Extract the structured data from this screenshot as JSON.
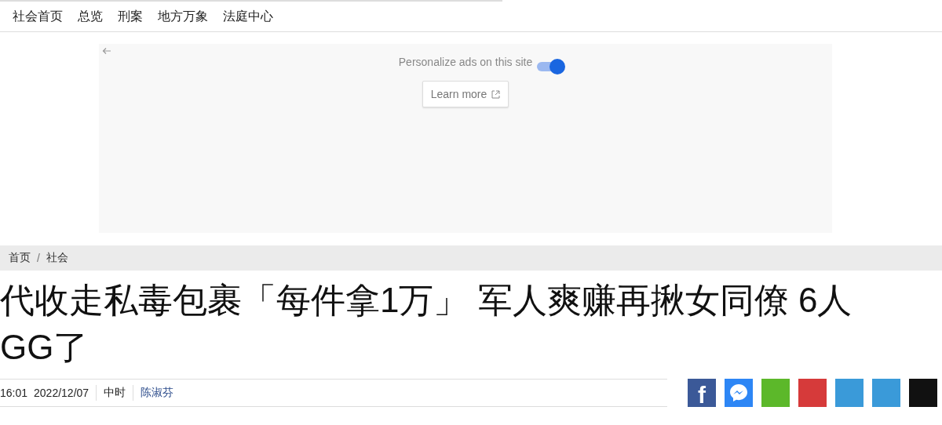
{
  "nav": {
    "items": [
      {
        "label": "社会首页"
      },
      {
        "label": "总览"
      },
      {
        "label": "刑案"
      },
      {
        "label": "地方万象"
      },
      {
        "label": "法庭中心"
      }
    ]
  },
  "ad_settings": {
    "label": "Personalize ads on this site",
    "on": true,
    "button": "Learn more"
  },
  "breadcrumb": [
    {
      "label": "首页"
    },
    {
      "label": "社会"
    }
  ],
  "breadcrumb_separator": "/",
  "headline": "代收走私毒包裹「每件拿1万」 军人爽赚再揪女同僚 6人GG了",
  "meta": {
    "time": "16:01",
    "date": "2022/12/07",
    "source": "中时",
    "author": "陈淑芬"
  },
  "share": [
    {
      "kind": "facebook",
      "color": "#3b5998",
      "glyph": "f"
    },
    {
      "kind": "messenger",
      "color": "#2d86f5"
    },
    {
      "kind": "plain",
      "color": "#5cb82a"
    },
    {
      "kind": "plain",
      "color": "#d63a3a"
    },
    {
      "kind": "plain",
      "color": "#3a9ad9"
    },
    {
      "kind": "plain",
      "color": "#3a9ad9"
    },
    {
      "kind": "plain",
      "color": "#111111"
    }
  ]
}
